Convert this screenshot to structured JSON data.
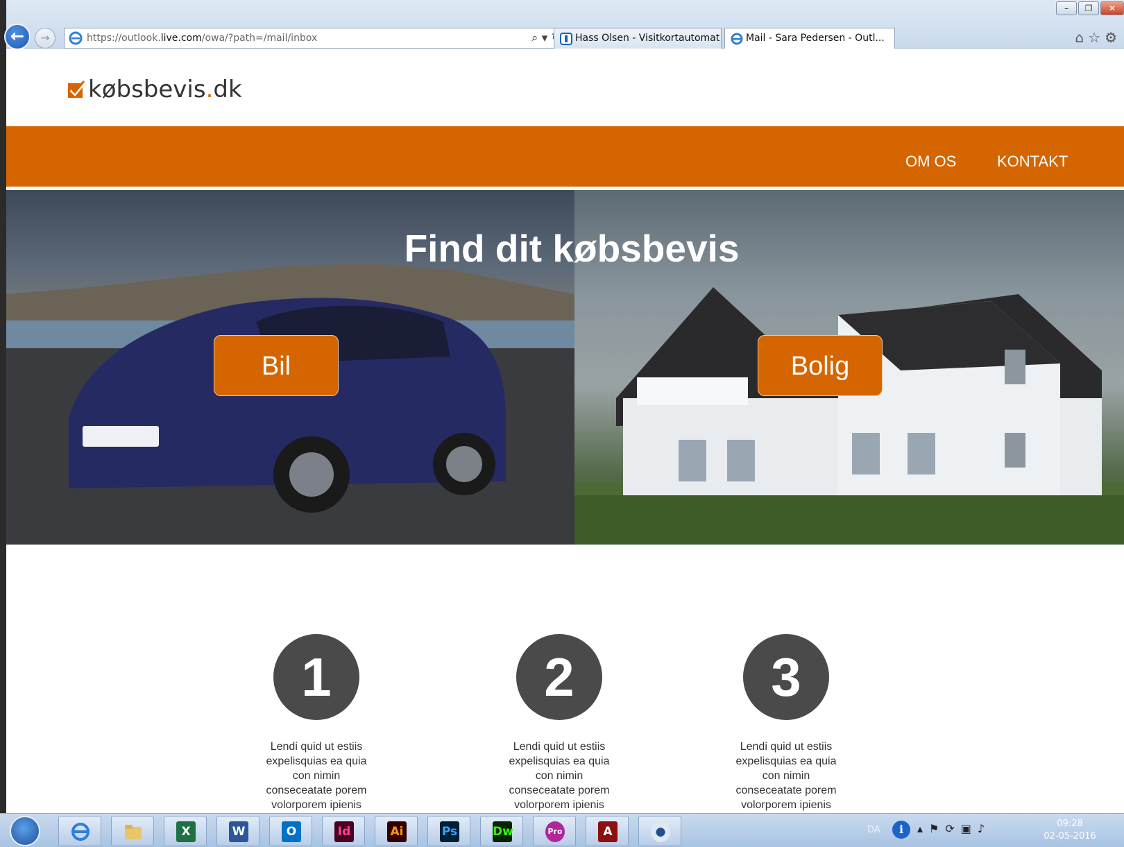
{
  "browser": {
    "url_prefix": "https://outlook.",
    "url_host": "live.com",
    "url_path": "/owa/?path=/mail/inbox",
    "tabs": [
      {
        "label": "Hass Olsen - Visitkortautomat"
      },
      {
        "label": "Mail - Sara Pedersen - Outl...",
        "close": "×"
      }
    ]
  },
  "site": {
    "logo_main": "købsbevis",
    "logo_dot": ".",
    "logo_tld": "dk",
    "nav": {
      "about": "OM OS",
      "contact": "KONTAKT"
    },
    "hero": {
      "title": "Find dit købsbevis",
      "car_button": "Bil",
      "house_button": "Bolig"
    },
    "steps": [
      {
        "number": "1",
        "text": "Lendi quid ut estiis expelisquias ea quia con nimin conseceatate porem volorporem ipienis"
      },
      {
        "number": "2",
        "text": "Lendi quid ut estiis expelisquias ea quia con nimin conseceatate porem volorporem ipienis"
      },
      {
        "number": "3",
        "text": "Lendi quid ut estiis expelisquias ea quia con nimin conseceatate porem volorporem ipienis"
      }
    ],
    "accent_color": "#d56500"
  },
  "taskbar": {
    "apps": [
      {
        "name": "internet-explorer"
      },
      {
        "name": "file-explorer"
      },
      {
        "name": "excel",
        "glyph": "X"
      },
      {
        "name": "word",
        "glyph": "W"
      },
      {
        "name": "outlook",
        "glyph": "O"
      },
      {
        "name": "indesign",
        "glyph": "Id"
      },
      {
        "name": "illustrator",
        "glyph": "Ai"
      },
      {
        "name": "photoshop",
        "glyph": "Ps"
      },
      {
        "name": "dreamweaver",
        "glyph": "Dw"
      },
      {
        "name": "pro-app",
        "glyph": "Pro"
      },
      {
        "name": "acrobat",
        "glyph": "A"
      },
      {
        "name": "media-app",
        "glyph": "●"
      }
    ],
    "language": "DA",
    "time": "09:28",
    "date": "02-05-2016"
  }
}
